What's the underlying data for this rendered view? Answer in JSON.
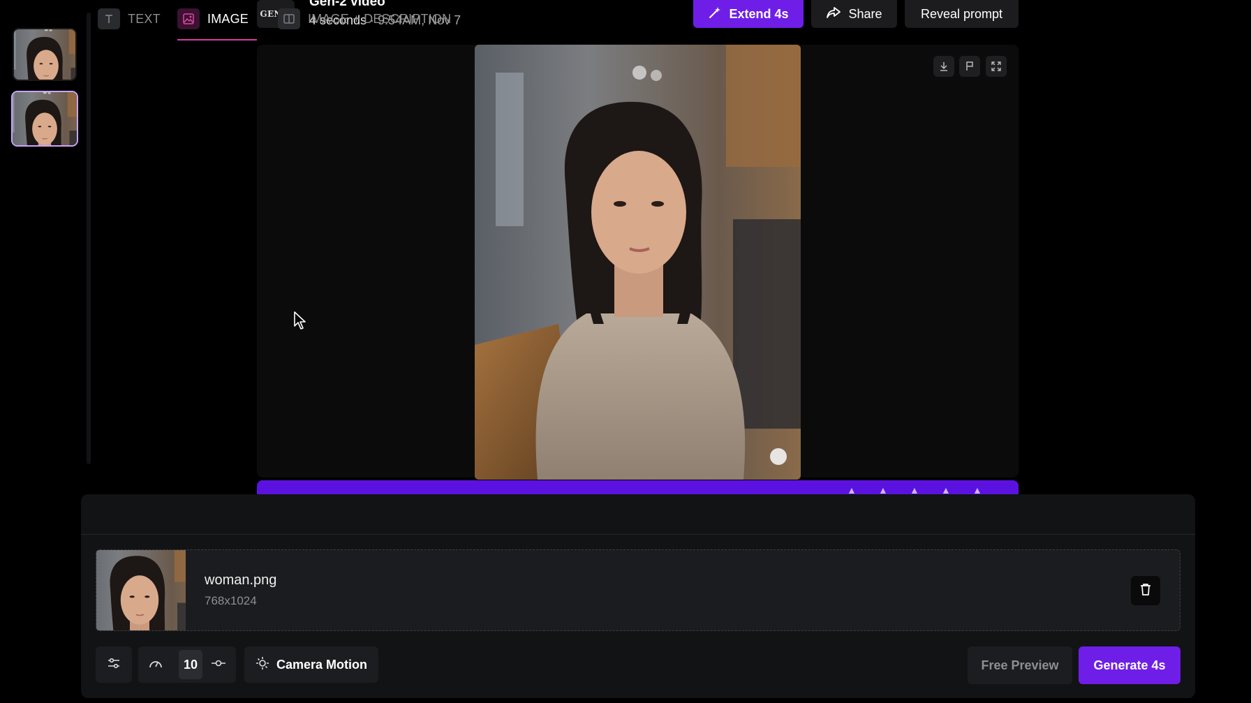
{
  "header": {
    "badge": "GEN-2",
    "title": "Gen-2 video",
    "duration": "4 seconds",
    "separator": "·",
    "time": "9:54AM, Nov 7",
    "extend_label": "Extend 4s",
    "share_label": "Share",
    "reveal_label": "Reveal prompt"
  },
  "player": {
    "controls": [
      "download-icon",
      "flag-icon",
      "fullscreen-icon"
    ]
  },
  "tabs": [
    {
      "label": "TEXT",
      "icon": "text-icon"
    },
    {
      "label": "IMAGE",
      "icon": "image-icon",
      "active": true
    },
    {
      "label": "IMAGE + DESCRIPTION",
      "icon": "split-icon"
    }
  ],
  "upload": {
    "file_name": "woman.png",
    "dimensions": "768x1024"
  },
  "toolbar": {
    "motion_value": "10",
    "camera_label": "Camera Motion",
    "preview_label": "Free Preview",
    "generate_label": "Generate 4s"
  },
  "colors": {
    "accent": "#6f1ee8",
    "active_tab_underline": "#d63aa8",
    "background": "#000000",
    "panel": "#121315"
  }
}
